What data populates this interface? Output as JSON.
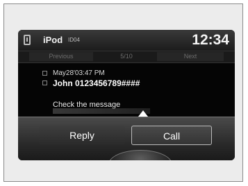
{
  "status": {
    "source": "iPod",
    "source_sub": "ID04",
    "time": "12:34"
  },
  "nav": {
    "previous": "Previous",
    "count": "5/10",
    "next": "Next"
  },
  "message": {
    "timestamp": "May28'03:47 PM",
    "from": "John 0123456789####",
    "preview": "Check the message"
  },
  "actions": {
    "reply": "Reply",
    "call": "Call"
  }
}
